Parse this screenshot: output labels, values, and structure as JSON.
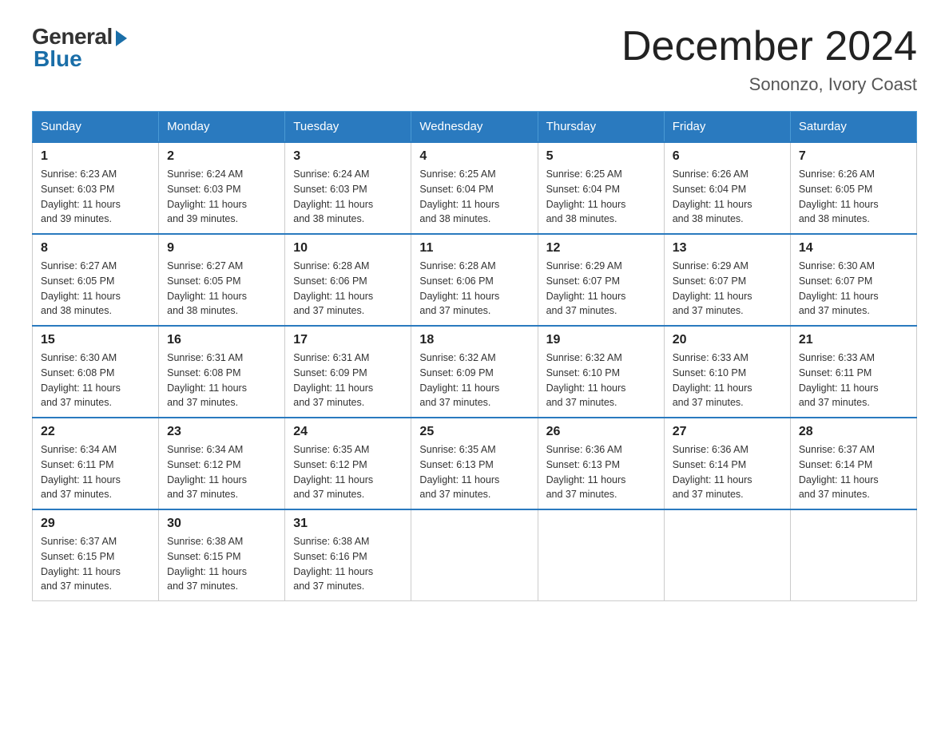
{
  "logo": {
    "general": "General",
    "blue": "Blue"
  },
  "header": {
    "month": "December 2024",
    "location": "Sononzo, Ivory Coast"
  },
  "days_of_week": [
    "Sunday",
    "Monday",
    "Tuesday",
    "Wednesday",
    "Thursday",
    "Friday",
    "Saturday"
  ],
  "weeks": [
    [
      {
        "day": "1",
        "sunrise": "6:23 AM",
        "sunset": "6:03 PM",
        "daylight": "11 hours and 39 minutes."
      },
      {
        "day": "2",
        "sunrise": "6:24 AM",
        "sunset": "6:03 PM",
        "daylight": "11 hours and 39 minutes."
      },
      {
        "day": "3",
        "sunrise": "6:24 AM",
        "sunset": "6:03 PM",
        "daylight": "11 hours and 38 minutes."
      },
      {
        "day": "4",
        "sunrise": "6:25 AM",
        "sunset": "6:04 PM",
        "daylight": "11 hours and 38 minutes."
      },
      {
        "day": "5",
        "sunrise": "6:25 AM",
        "sunset": "6:04 PM",
        "daylight": "11 hours and 38 minutes."
      },
      {
        "day": "6",
        "sunrise": "6:26 AM",
        "sunset": "6:04 PM",
        "daylight": "11 hours and 38 minutes."
      },
      {
        "day": "7",
        "sunrise": "6:26 AM",
        "sunset": "6:05 PM",
        "daylight": "11 hours and 38 minutes."
      }
    ],
    [
      {
        "day": "8",
        "sunrise": "6:27 AM",
        "sunset": "6:05 PM",
        "daylight": "11 hours and 38 minutes."
      },
      {
        "day": "9",
        "sunrise": "6:27 AM",
        "sunset": "6:05 PM",
        "daylight": "11 hours and 38 minutes."
      },
      {
        "day": "10",
        "sunrise": "6:28 AM",
        "sunset": "6:06 PM",
        "daylight": "11 hours and 37 minutes."
      },
      {
        "day": "11",
        "sunrise": "6:28 AM",
        "sunset": "6:06 PM",
        "daylight": "11 hours and 37 minutes."
      },
      {
        "day": "12",
        "sunrise": "6:29 AM",
        "sunset": "6:07 PM",
        "daylight": "11 hours and 37 minutes."
      },
      {
        "day": "13",
        "sunrise": "6:29 AM",
        "sunset": "6:07 PM",
        "daylight": "11 hours and 37 minutes."
      },
      {
        "day": "14",
        "sunrise": "6:30 AM",
        "sunset": "6:07 PM",
        "daylight": "11 hours and 37 minutes."
      }
    ],
    [
      {
        "day": "15",
        "sunrise": "6:30 AM",
        "sunset": "6:08 PM",
        "daylight": "11 hours and 37 minutes."
      },
      {
        "day": "16",
        "sunrise": "6:31 AM",
        "sunset": "6:08 PM",
        "daylight": "11 hours and 37 minutes."
      },
      {
        "day": "17",
        "sunrise": "6:31 AM",
        "sunset": "6:09 PM",
        "daylight": "11 hours and 37 minutes."
      },
      {
        "day": "18",
        "sunrise": "6:32 AM",
        "sunset": "6:09 PM",
        "daylight": "11 hours and 37 minutes."
      },
      {
        "day": "19",
        "sunrise": "6:32 AM",
        "sunset": "6:10 PM",
        "daylight": "11 hours and 37 minutes."
      },
      {
        "day": "20",
        "sunrise": "6:33 AM",
        "sunset": "6:10 PM",
        "daylight": "11 hours and 37 minutes."
      },
      {
        "day": "21",
        "sunrise": "6:33 AM",
        "sunset": "6:11 PM",
        "daylight": "11 hours and 37 minutes."
      }
    ],
    [
      {
        "day": "22",
        "sunrise": "6:34 AM",
        "sunset": "6:11 PM",
        "daylight": "11 hours and 37 minutes."
      },
      {
        "day": "23",
        "sunrise": "6:34 AM",
        "sunset": "6:12 PM",
        "daylight": "11 hours and 37 minutes."
      },
      {
        "day": "24",
        "sunrise": "6:35 AM",
        "sunset": "6:12 PM",
        "daylight": "11 hours and 37 minutes."
      },
      {
        "day": "25",
        "sunrise": "6:35 AM",
        "sunset": "6:13 PM",
        "daylight": "11 hours and 37 minutes."
      },
      {
        "day": "26",
        "sunrise": "6:36 AM",
        "sunset": "6:13 PM",
        "daylight": "11 hours and 37 minutes."
      },
      {
        "day": "27",
        "sunrise": "6:36 AM",
        "sunset": "6:14 PM",
        "daylight": "11 hours and 37 minutes."
      },
      {
        "day": "28",
        "sunrise": "6:37 AM",
        "sunset": "6:14 PM",
        "daylight": "11 hours and 37 minutes."
      }
    ],
    [
      {
        "day": "29",
        "sunrise": "6:37 AM",
        "sunset": "6:15 PM",
        "daylight": "11 hours and 37 minutes."
      },
      {
        "day": "30",
        "sunrise": "6:38 AM",
        "sunset": "6:15 PM",
        "daylight": "11 hours and 37 minutes."
      },
      {
        "day": "31",
        "sunrise": "6:38 AM",
        "sunset": "6:16 PM",
        "daylight": "11 hours and 37 minutes."
      },
      null,
      null,
      null,
      null
    ]
  ],
  "labels": {
    "sunrise": "Sunrise:",
    "sunset": "Sunset:",
    "daylight": "Daylight:"
  }
}
